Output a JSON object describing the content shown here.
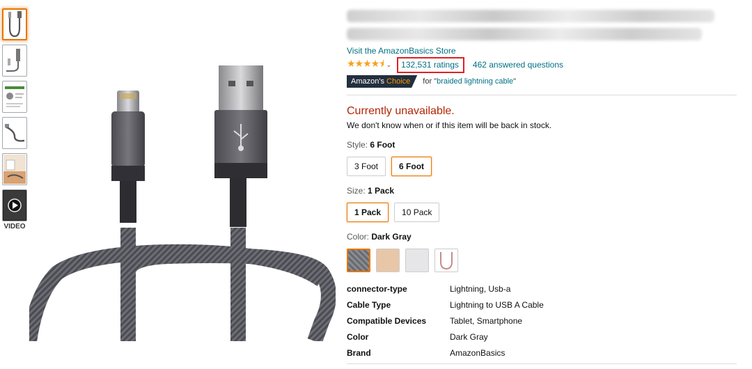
{
  "thumbnails": [
    {
      "name": "thumb-cable-front",
      "selected": true
    },
    {
      "name": "thumb-cable-connector"
    },
    {
      "name": "thumb-infographic"
    },
    {
      "name": "thumb-cable-angle"
    },
    {
      "name": "thumb-lifestyle"
    },
    {
      "name": "thumb-video"
    }
  ],
  "video_label": "VIDEO",
  "store_link": "Visit the AmazonBasics Store",
  "rating": {
    "stars": "★★★★⯨",
    "count_label": "132,531 ratings",
    "answered": "462 answered questions"
  },
  "badge": {
    "amazons": "Amazon's",
    "choice": "Choice",
    "for_prefix": "for \"",
    "for_query": "braided lightning cable",
    "for_suffix": "\""
  },
  "availability": {
    "status": "Currently unavailable.",
    "note": "We don't know when or if this item will be back in stock."
  },
  "style": {
    "label": "Style: ",
    "selected": "6 Foot",
    "options": [
      "3 Foot",
      "6 Foot"
    ]
  },
  "size": {
    "label": "Size: ",
    "selected": "1 Pack",
    "options": [
      "1 Pack",
      "10 Pack"
    ]
  },
  "color": {
    "label": "Color: ",
    "selected": "Dark Gray",
    "swatches": [
      "#7c7d82",
      "#e8c7a8",
      "#e6e6e8",
      "#f5f5f5"
    ]
  },
  "specs": [
    {
      "key": "connector-type",
      "value": "Lightning, Usb-a"
    },
    {
      "key": "Cable Type",
      "value": "Lightning to USB A Cable"
    },
    {
      "key": "Compatible Devices",
      "value": "Tablet, Smartphone"
    },
    {
      "key": "Color",
      "value": "Dark Gray"
    },
    {
      "key": "Brand",
      "value": "AmazonBasics"
    }
  ],
  "colors": {
    "link": "#007185",
    "unavailable": "#b12704",
    "star": "#f6a21e",
    "highlight_box": "#e02020",
    "selected_border": "#e77600"
  }
}
